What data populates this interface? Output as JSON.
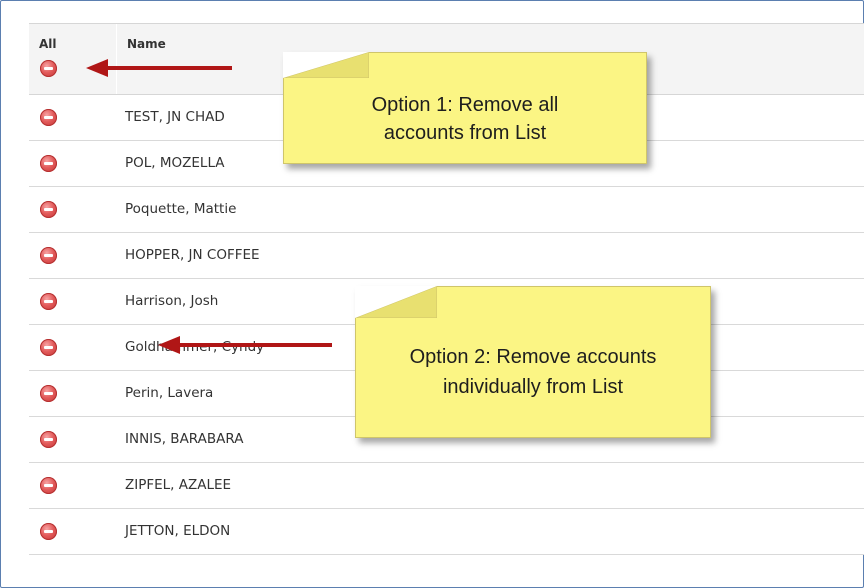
{
  "grid": {
    "columns": {
      "all": "All",
      "name": "Name"
    },
    "rows": [
      {
        "name": "TEST, JN CHAD"
      },
      {
        "name": "POL, MOZELLA"
      },
      {
        "name": "Poquette, Mattie"
      },
      {
        "name": "HOPPER, JN COFFEE"
      },
      {
        "name": "Harrison, Josh"
      },
      {
        "name": "Goldhammer, Cyndy"
      },
      {
        "name": "Perin, Lavera"
      },
      {
        "name": "INNIS, BARABARA"
      },
      {
        "name": "ZIPFEL, AZALEE"
      },
      {
        "name": "JETTON, ELDON"
      }
    ]
  },
  "callouts": {
    "option1": {
      "line1": "Option 1: Remove all",
      "line2": "accounts from List"
    },
    "option2": {
      "line1": "Option 2: Remove accounts",
      "line2": "individually from List"
    }
  },
  "colors": {
    "note_bg": "#fbf584",
    "arrow": "#b01616",
    "remove_icon": "#e25b5b",
    "frame": "#5b7fb0"
  },
  "icons": {
    "remove": "minus-circle-icon"
  }
}
